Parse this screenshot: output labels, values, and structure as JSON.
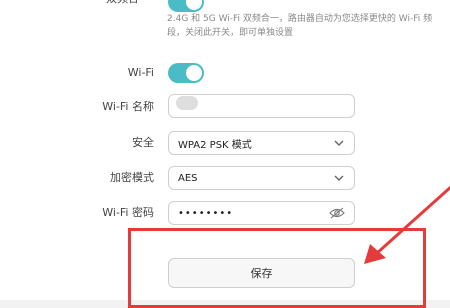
{
  "top": {
    "partial_label": "双频合一",
    "hint": "2.4G 和 5G Wi-Fi 双频合一，路由器自动为您选择更快的 Wi-Fi 频段，关闭此开关，即可单独设置"
  },
  "wifi": {
    "label": "Wi-Fi",
    "enabled": true
  },
  "name": {
    "label": "Wi-Fi 名称",
    "value": ""
  },
  "security": {
    "label": "安全",
    "value": "WPA2 PSK 模式"
  },
  "encryption": {
    "label": "加密模式",
    "value": "AES"
  },
  "password": {
    "label": "Wi-Fi 密码",
    "value": "••••••••"
  },
  "actions": {
    "save_label": "保存"
  },
  "colors": {
    "toggle": "#4bbcc6",
    "annotation": "#e53b3b"
  },
  "icons": {
    "select": "chevron-down-icon",
    "password_visibility": "eye-icon"
  }
}
